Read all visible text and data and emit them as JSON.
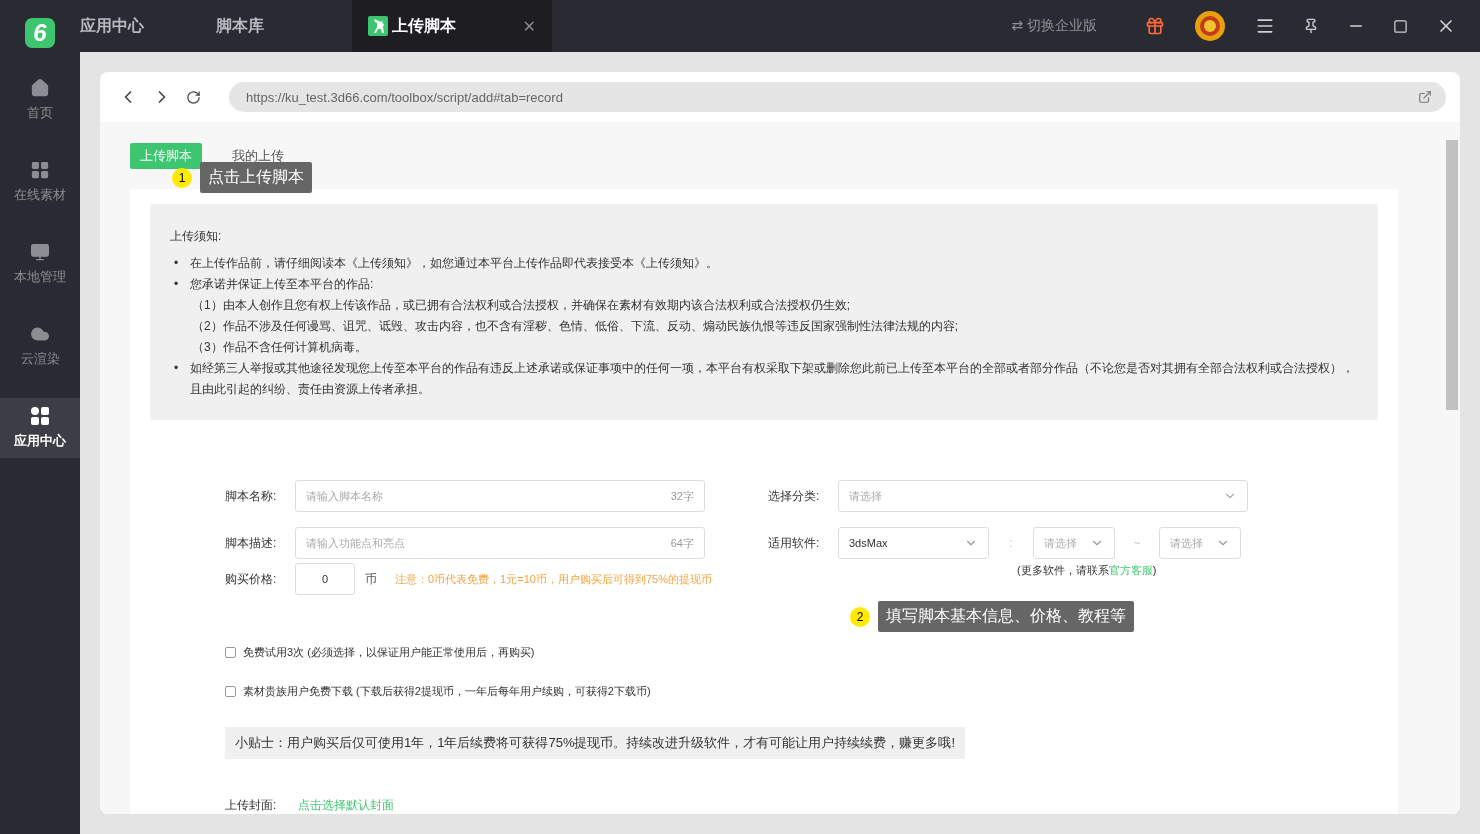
{
  "logo": "6",
  "sidebar": {
    "items": [
      {
        "label": "首页",
        "selected": false
      },
      {
        "label": "在线素材",
        "selected": false
      },
      {
        "label": "本地管理",
        "selected": false
      },
      {
        "label": "云渲染",
        "selected": false
      },
      {
        "label": "应用中心",
        "selected": true
      }
    ]
  },
  "tabs": [
    {
      "label": "应用中心",
      "selected": false
    },
    {
      "label": "脚本库",
      "selected": false
    },
    {
      "label": "上传脚本",
      "selected": true,
      "close": "✕"
    }
  ],
  "title_bar": {
    "switch_label": "⇄ 切换企业版"
  },
  "browser": {
    "url": "https://ku_test.3d66.com/toolbox/script/add#tab=record"
  },
  "page_tabs": [
    {
      "label": "上传脚本",
      "selected": true
    },
    {
      "label": "我的上传",
      "selected": false
    }
  ],
  "notice": {
    "title": "上传须知:",
    "items": [
      {
        "bullet": "•",
        "text": "在上传作品前，请仔细阅读本《上传须知》，如您通过本平台上传作品即代表接受本《上传须知》。"
      },
      {
        "bullet": "•",
        "text": "您承诺并保证上传至本平台的作品:",
        "children": [
          "（1）由本人创作且您有权上传该作品，或已拥有合法权利或合法授权，并确保在素材有效期内该合法权利或合法授权仍生效;",
          "（2）作品不涉及任何谩骂、诅咒、诋毁、攻击内容，也不含有淫秽、色情、低俗、下流、反动、煽动民族仇恨等违反国家强制性法律法规的内容;",
          "（3）作品不含任何计算机病毒。"
        ]
      },
      {
        "bullet": "•",
        "text": "如经第三人举报或其他途径发现您上传至本平台的作品有违反上述承诺或保证事项中的任何一项，本平台有权采取下架或删除您此前已上传至本平台的全部或者部分作品（不论您是否对其拥有全部合法权利或合法授权），且由此引起的纠纷、责任由资源上传者承担。"
      }
    ]
  },
  "form": {
    "name": {
      "label": "脚本名称:",
      "placeholder": "请输入脚本名称",
      "counter": "32字"
    },
    "category": {
      "label": "选择分类:",
      "placeholder": "请选择"
    },
    "description": {
      "label": "脚本描述:",
      "placeholder": "请输入功能点和亮点",
      "counter": "64字"
    },
    "software": {
      "label": "适用软件:",
      "value": "3dsMax",
      "separator": ":",
      "version_from": "请选择",
      "tilde": "~",
      "version_to": "请选择",
      "hint": "(更多软件，请联系",
      "hint_link": "官方客服",
      "hint_end": ")"
    },
    "price": {
      "label": "购买价格:",
      "value": "0",
      "unit": "币",
      "note": "注意：0币代表免费，1元=10币，用户购买后可得到75%的提现币"
    },
    "options": [
      {
        "label": "免费试用3次 (必须选择，以保证用户能正常使用后，再购买)",
        "checked": false
      },
      {
        "label": "素材贵族用户免费下载 (下载后获得2提现币，一年后每年用户续购，可获得2下载币)",
        "checked": false
      }
    ],
    "tip": "小贴士：用户购买后仅可使用1年，1年后续费将可获得75%提现币。持续改进升级软件，才有可能让用户持续续费，赚更多哦!",
    "cover": {
      "label": "上传封面:",
      "link": "点击选择默认封面"
    }
  },
  "annotations": [
    {
      "number": "1",
      "text": "点击上传脚本"
    },
    {
      "number": "2",
      "text": "填写脚本基本信息、价格、教程等"
    }
  ]
}
